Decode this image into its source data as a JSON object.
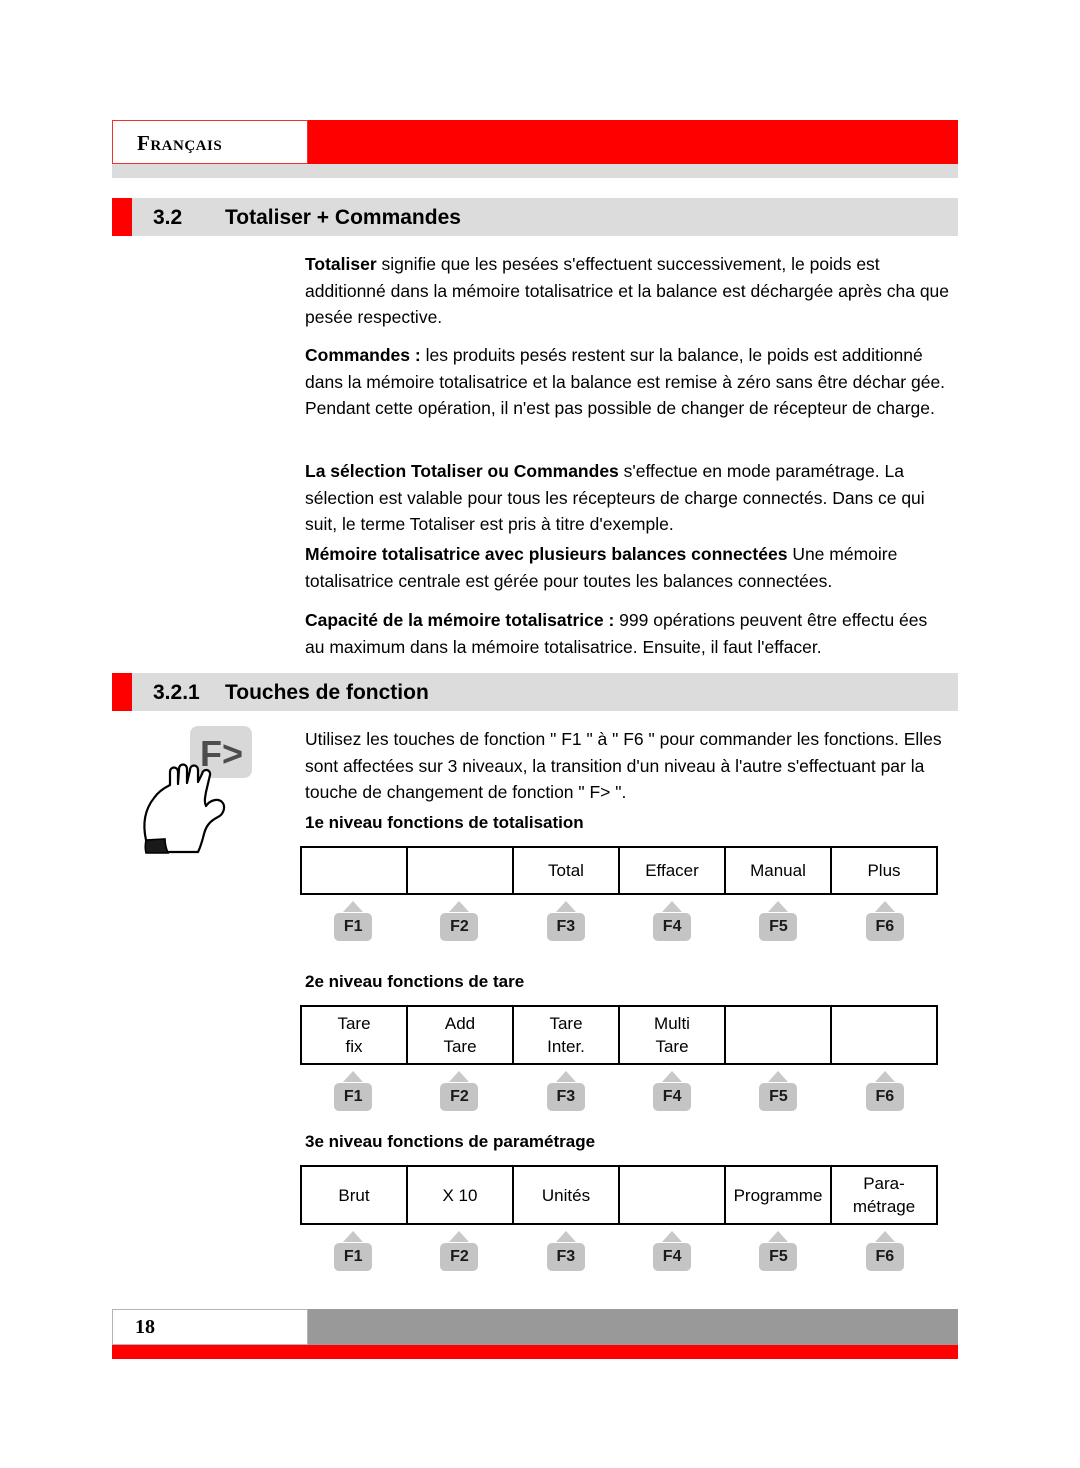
{
  "header": {
    "language_tab": "Français",
    "accent_color": "#ff0000",
    "bar_color": "#dcdcdc"
  },
  "sections": {
    "s32": {
      "number": "3.2",
      "title": "Totaliser + Commandes"
    },
    "s321": {
      "number": "3.2.1",
      "title": "Touches de fonction"
    }
  },
  "body": {
    "p1_lead": "Totaliser",
    "p1_rest": " signifie que les pesées s'effectuent successivement, le poids est additionné dans la mémoire totalisatrice et la balance est déchargée après cha que pesée respective.",
    "p2_lead": "Commandes :",
    "p2_rest": " les produits pesés restent sur la balance, le poids est additionné dans la mémoire totalisatrice et la balance est remise à zéro sans être déchar gée. Pendant cette opération, il n'est pas possible de changer de récepteur de charge.",
    "p3_lead": "La sélection Totaliser ou Commandes",
    "p3_rest": " s'effectue en mode paramétrage. La sélection est valable pour tous les récepteurs de charge connectés. Dans ce qui suit, le terme Totaliser est pris à titre d'exemple.",
    "p4_lead": "Mémoire totalisatrice avec plusieurs balances connectées",
    "p4_rest": " Une mémoire totalisatrice centrale est gérée pour toutes les balances connectées.",
    "p5_lead": "Capacité de la mémoire totalisatrice :",
    "p5_rest": " 999 opérations peuvent être effectu ées au maximum dans la mémoire totalisatrice. Ensuite, il faut l'effacer.",
    "intro": "Utilisez les touches de fonction \" F1 \" à \" F6 \" pour commander les fonctions. Elles sont affectées sur 3 niveaux, la transition d'un niveau à l'autre s'effectuant par la touche de changement de fonction \" F> \"."
  },
  "hand_icon": {
    "key_label": "F>",
    "key_color": "#d8d8d8"
  },
  "levels": [
    {
      "title": "1e niveau fonctions de totalisation",
      "lines": 1,
      "cells": [
        {
          "line1": "",
          "line2": ""
        },
        {
          "line1": "",
          "line2": ""
        },
        {
          "line1": "Total",
          "line2": ""
        },
        {
          "line1": "Effacer",
          "line2": ""
        },
        {
          "line1": "Manual",
          "line2": ""
        },
        {
          "line1": "Plus",
          "line2": ""
        }
      ],
      "fkeys": [
        "F1",
        "F2",
        "F3",
        "F4",
        "F5",
        "F6"
      ]
    },
    {
      "title": "2e niveau fonctions de tare",
      "lines": 2,
      "cells": [
        {
          "line1": "Tare",
          "line2": "fix"
        },
        {
          "line1": "Add",
          "line2": "Tare"
        },
        {
          "line1": "Tare",
          "line2": "Inter."
        },
        {
          "line1": "Multi",
          "line2": "Tare"
        },
        {
          "line1": "",
          "line2": ""
        },
        {
          "line1": "",
          "line2": ""
        }
      ],
      "fkeys": [
        "F1",
        "F2",
        "F3",
        "F4",
        "F5",
        "F6"
      ]
    },
    {
      "title": "3e niveau fonctions de paramétrage",
      "lines": 2,
      "cells": [
        {
          "line1": "Brut",
          "line2": ""
        },
        {
          "line1": "X 10",
          "line2": ""
        },
        {
          "line1": "Unités",
          "line2": ""
        },
        {
          "line1": "",
          "line2": ""
        },
        {
          "line1": "Programme",
          "line2": ""
        },
        {
          "line1": "Para-",
          "line2": "métrage"
        }
      ],
      "fkeys": [
        "F1",
        "F2",
        "F3",
        "F4",
        "F5",
        "F6"
      ]
    }
  ],
  "footer": {
    "page_number": "18",
    "bar_color": "#999999",
    "accent_color": "#ff0000"
  }
}
